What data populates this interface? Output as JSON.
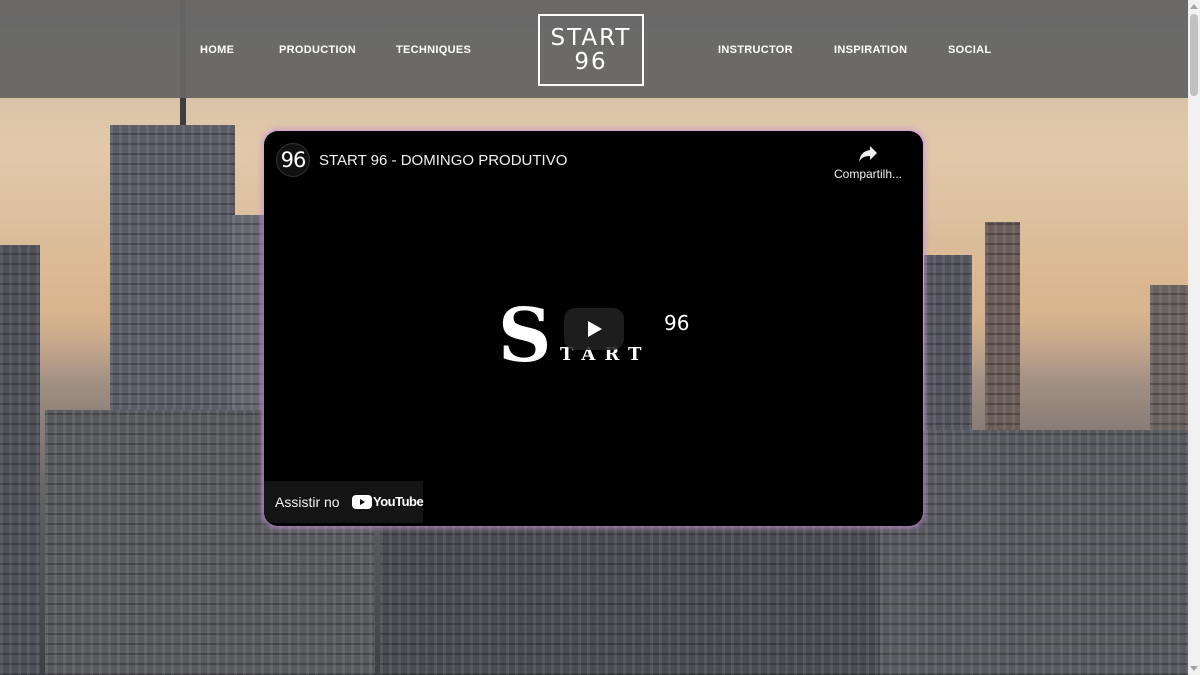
{
  "nav": {
    "left": [
      {
        "label": "HOME"
      },
      {
        "label": "PRODUCTION"
      },
      {
        "label": "TECHNIQUES"
      }
    ],
    "right": [
      {
        "label": "INSTRUCTOR"
      },
      {
        "label": "INSPIRATION"
      },
      {
        "label": "SOCIAL"
      }
    ]
  },
  "logo": {
    "line1": "START",
    "line2": "96"
  },
  "video": {
    "channel_icon_text": "96",
    "title": "START 96 - DOMINGO PRODUTIVO",
    "share_label": "Compartilh...",
    "thumbnail": {
      "big_letter": "S",
      "rest": "TART",
      "number": "96"
    },
    "watch_on": "Assistir no",
    "youtube_label": "YouTube"
  },
  "colors": {
    "header_bg": "#666666",
    "video_glow": "#c88cdc",
    "video_bg": "#000000"
  }
}
